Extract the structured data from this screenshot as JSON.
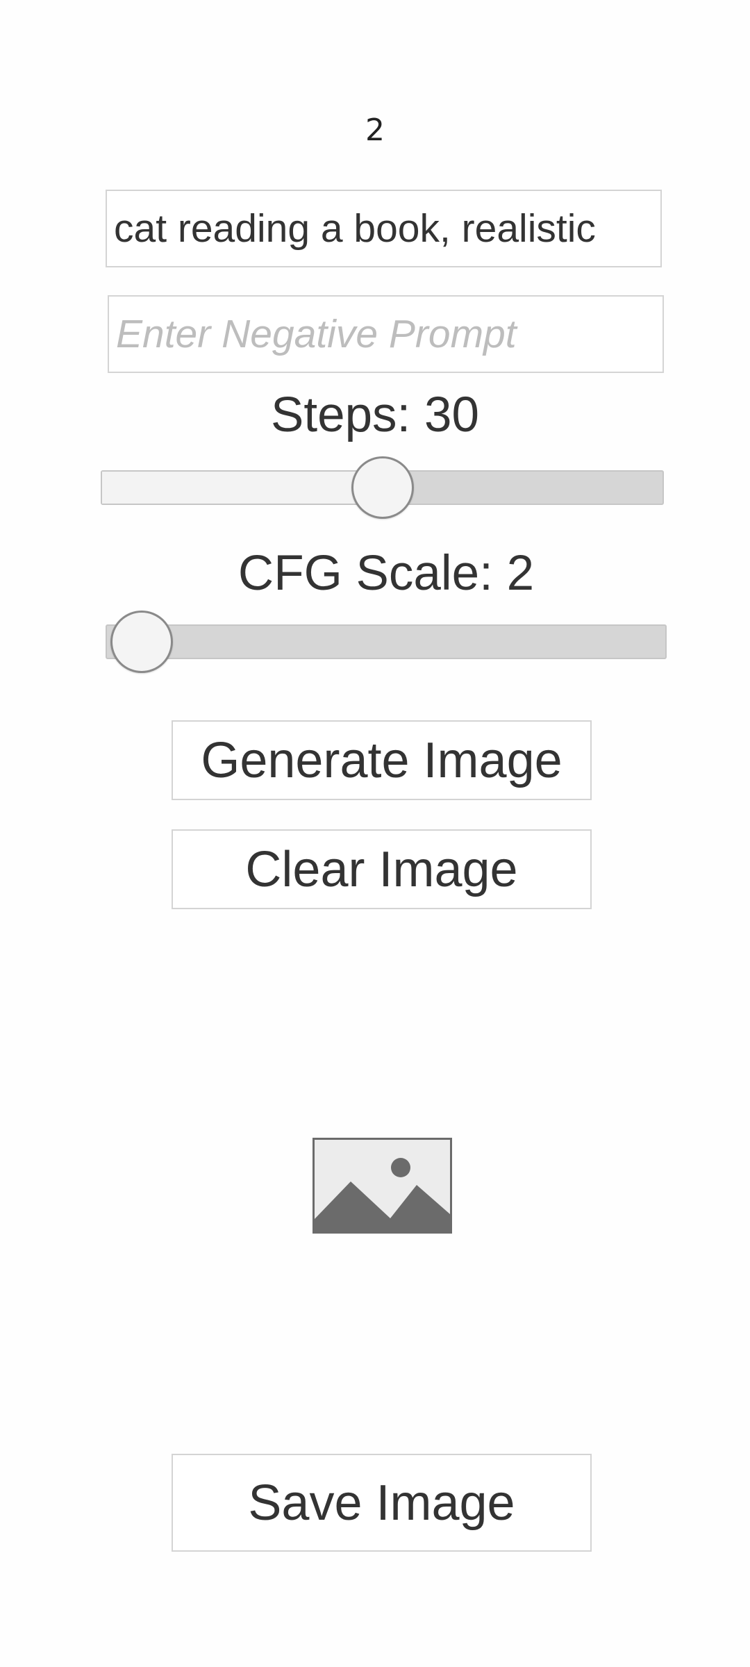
{
  "counter": "2",
  "prompt": {
    "value": "cat reading a book, realistic"
  },
  "negative_prompt": {
    "value": "",
    "placeholder": "Enter Negative Prompt"
  },
  "steps": {
    "label": "Steps: 30",
    "value": 30,
    "fraction": 0.5
  },
  "cfg_scale": {
    "label": "CFG Scale: 2",
    "value": 2,
    "fraction": 0.0
  },
  "buttons": {
    "generate_label": "Generate Image",
    "clear_label": "Clear Image",
    "save_label": "Save Image"
  },
  "output_image": {
    "icon": "image-placeholder-icon"
  }
}
